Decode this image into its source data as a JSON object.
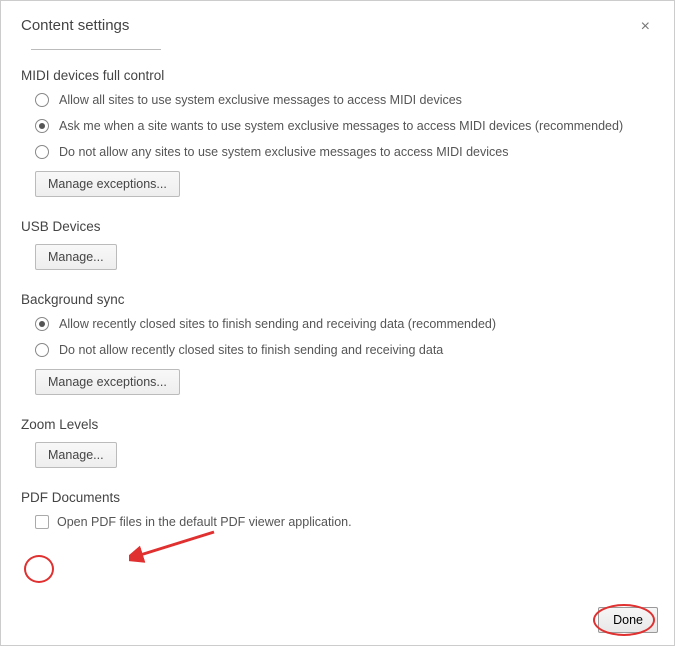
{
  "dialog": {
    "title": "Content settings",
    "close_glyph": "×"
  },
  "sections": {
    "midi": {
      "title": "MIDI devices full control",
      "options": [
        "Allow all sites to use system exclusive messages to access MIDI devices",
        "Ask me when a site wants to use system exclusive messages to access MIDI devices (recommended)",
        "Do not allow any sites to use system exclusive messages to access MIDI devices"
      ],
      "selected_index": 1,
      "manage_label": "Manage exceptions..."
    },
    "usb": {
      "title": "USB Devices",
      "manage_label": "Manage..."
    },
    "bgsync": {
      "title": "Background sync",
      "options": [
        "Allow recently closed sites to finish sending and receiving data (recommended)",
        "Do not allow recently closed sites to finish sending and receiving data"
      ],
      "selected_index": 0,
      "manage_label": "Manage exceptions..."
    },
    "zoom": {
      "title": "Zoom Levels",
      "manage_label": "Manage..."
    },
    "pdf": {
      "title": "PDF Documents",
      "checkbox_label": "Open PDF files in the default PDF viewer application.",
      "checked": false
    }
  },
  "footer": {
    "done_label": "Done"
  }
}
